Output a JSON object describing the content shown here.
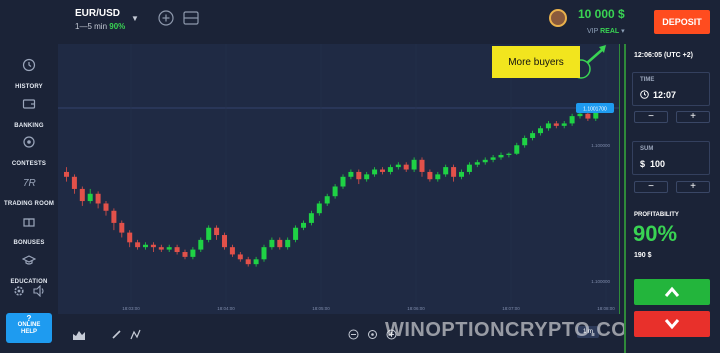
{
  "header": {
    "pair": "EUR/USD",
    "duration": "1—5 min",
    "payout": "90%",
    "balance": "10 000 $",
    "account_prefix": "VIP",
    "account_type": "REAL",
    "deposit_label": "DEPOSIT"
  },
  "sidebar": {
    "items": [
      {
        "label": "HISTORY",
        "icon": "history-icon"
      },
      {
        "label": "BANKING",
        "icon": "wallet-icon"
      },
      {
        "label": "CONTESTS",
        "icon": "trophy-icon"
      },
      {
        "label": "TRADING ROOM",
        "icon": "trading-room-icon"
      },
      {
        "label": "BONUSES",
        "icon": "gift-icon"
      },
      {
        "label": "EDUCATION",
        "icon": "graduation-cap-icon"
      }
    ],
    "help_label_1": "ONLINE",
    "help_label_2": "HELP"
  },
  "chart": {
    "callout": "More buyers",
    "current_price": "1.1001700",
    "price_mid": "1.100000",
    "price_low": "1.100000",
    "time_labels": [
      "18:03:00",
      "18:04:00",
      "18:05:00",
      "18:06:00",
      "18:07:00",
      "18:08:00"
    ],
    "timeframe": "1 m",
    "watermark": "WINOPTIONCRYPTO.COM"
  },
  "panel": {
    "clock": "12:06:05 (UTC +2)",
    "time_caption": "TIME",
    "time_value": "12:07",
    "sum_caption": "SUM",
    "sum_value": "100",
    "sum_currency": "$",
    "profitability_caption": "PROFITABILITY",
    "profitability_pct": "90%",
    "profitability_amount": "190 $"
  },
  "chart_data": {
    "type": "candlestick",
    "candles": [
      [
        40,
        38,
        42,
        36
      ],
      [
        38,
        33,
        39,
        31
      ],
      [
        33,
        28,
        34,
        26
      ],
      [
        28,
        31,
        33,
        27
      ],
      [
        31,
        27,
        32,
        25
      ],
      [
        27,
        24,
        28,
        22
      ],
      [
        24,
        19,
        25,
        16
      ],
      [
        19,
        15,
        20,
        13
      ],
      [
        15,
        11,
        16,
        9
      ],
      [
        11,
        9,
        12,
        8
      ],
      [
        9,
        10,
        11,
        8
      ],
      [
        10,
        9,
        11,
        7
      ],
      [
        9,
        8,
        10,
        7
      ],
      [
        8,
        9,
        10,
        7
      ],
      [
        9,
        7,
        10,
        6
      ],
      [
        7,
        5,
        8,
        4
      ],
      [
        5,
        8,
        9,
        4
      ],
      [
        8,
        12,
        13,
        7
      ],
      [
        12,
        17,
        18,
        11
      ],
      [
        17,
        14,
        18,
        12
      ],
      [
        14,
        9,
        15,
        8
      ],
      [
        9,
        6,
        10,
        5
      ],
      [
        6,
        4,
        7,
        3
      ],
      [
        4,
        2,
        5,
        1
      ],
      [
        2,
        4,
        5,
        1
      ],
      [
        4,
        9,
        10,
        3
      ],
      [
        9,
        12,
        13,
        8
      ],
      [
        12,
        9,
        13,
        8
      ],
      [
        9,
        12,
        13,
        8
      ],
      [
        12,
        17,
        18,
        11
      ],
      [
        17,
        19,
        20,
        16
      ],
      [
        19,
        23,
        24,
        18
      ],
      [
        23,
        27,
        28,
        22
      ],
      [
        27,
        30,
        31,
        26
      ],
      [
        30,
        34,
        35,
        29
      ],
      [
        34,
        38,
        39,
        33
      ],
      [
        38,
        40,
        41,
        37
      ],
      [
        40,
        37,
        41,
        35
      ],
      [
        37,
        39,
        40,
        36
      ],
      [
        39,
        41,
        42,
        38
      ],
      [
        41,
        40,
        42,
        39
      ],
      [
        40,
        42,
        43,
        39
      ],
      [
        42,
        43,
        44,
        41
      ],
      [
        43,
        41,
        44,
        40
      ],
      [
        41,
        45,
        46,
        40
      ],
      [
        45,
        40,
        46,
        38
      ],
      [
        40,
        37,
        41,
        36
      ],
      [
        37,
        39,
        40,
        36
      ],
      [
        39,
        42,
        43,
        38
      ],
      [
        42,
        38,
        43,
        36
      ],
      [
        38,
        40,
        41,
        37
      ],
      [
        40,
        43,
        44,
        39
      ],
      [
        43,
        44,
        45,
        42
      ],
      [
        44,
        45,
        46,
        43
      ],
      [
        45,
        46,
        47,
        44
      ],
      [
        46,
        47,
        48,
        45
      ],
      [
        47,
        47.5,
        48,
        46
      ],
      [
        47.5,
        51,
        52,
        47
      ],
      [
        51,
        54,
        55,
        50
      ],
      [
        54,
        56,
        57,
        53
      ],
      [
        56,
        58,
        59,
        55
      ],
      [
        58,
        60,
        61,
        57
      ],
      [
        60,
        59,
        61,
        58
      ],
      [
        59,
        60,
        61,
        58
      ],
      [
        60,
        63,
        64,
        59
      ],
      [
        63,
        64,
        65,
        62
      ],
      [
        64,
        62,
        65,
        61
      ],
      [
        62,
        66,
        67,
        61
      ]
    ]
  }
}
